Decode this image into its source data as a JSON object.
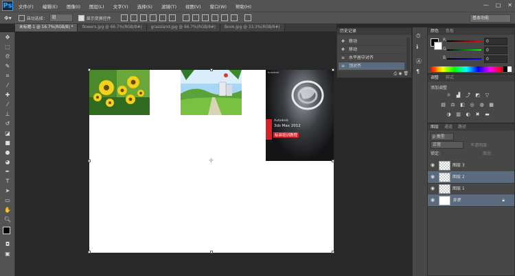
{
  "menubar": {
    "logo": "Ps",
    "items": [
      "文件(F)",
      "编辑(E)",
      "图像(I)",
      "图层(L)",
      "文字(Y)",
      "选择(S)",
      "滤镜(T)",
      "视图(V)",
      "窗口(W)",
      "帮助(H)"
    ],
    "window_controls": [
      "—",
      "□",
      "✕"
    ]
  },
  "options": {
    "auto_select_label": "自动选择：",
    "auto_select_value": "组",
    "show_transform_label": "显示变换控件",
    "workspace": "基本功能"
  },
  "tabs": [
    {
      "label": "未标题-1 @ 16.7%(RGB/8) *",
      "active": true
    },
    {
      "label": "flowers.jpg @ 66.7%(RGB/8#)",
      "active": false
    },
    {
      "label": "grassland.jpg @ 66.7%(RGB/8#)",
      "active": false
    },
    {
      "label": "Book.jpg @ 33.3%(RGB/8#)",
      "active": false
    }
  ],
  "history": {
    "title": "历史记录",
    "items": [
      {
        "label": "移动",
        "selected": false
      },
      {
        "label": "移动",
        "selected": false
      },
      {
        "label": "水平居中对齐",
        "selected": false
      },
      {
        "label": "顶对齐",
        "selected": true
      }
    ]
  },
  "color_panel": {
    "tabs": [
      "颜色",
      "色板"
    ],
    "channels": [
      {
        "name": "R",
        "value": "0",
        "color": "#d43a3a"
      },
      {
        "name": "G",
        "value": "0",
        "color": "#2fae3a"
      },
      {
        "name": "B",
        "value": "0",
        "color": "#3a55d4"
      }
    ]
  },
  "adjust_panel": {
    "tabs": [
      "调整",
      "样式"
    ],
    "subtitle": "添加调整"
  },
  "layers_panel": {
    "tabs": [
      "图层",
      "通道",
      "路径"
    ],
    "filter": "ρ 类型",
    "blend_mode": "正常",
    "opacity_label": "不透明度:",
    "lock_label": "锁定:",
    "fill_label": "填充:",
    "layers": [
      {
        "name": "图层 3",
        "selected": false
      },
      {
        "name": "图层 2",
        "selected": true
      },
      {
        "name": "图层 1",
        "selected": false
      },
      {
        "name": "背景",
        "selected": true
      }
    ]
  },
  "book": {
    "brand": "Autodesk",
    "title1": "Autodesk",
    "title2": "3ds Max 2012",
    "subtitle": "标准培训教程"
  },
  "colors": {
    "accent": "#31a8ff",
    "selection": "#5a6b80",
    "book_red": "#d8202a"
  }
}
